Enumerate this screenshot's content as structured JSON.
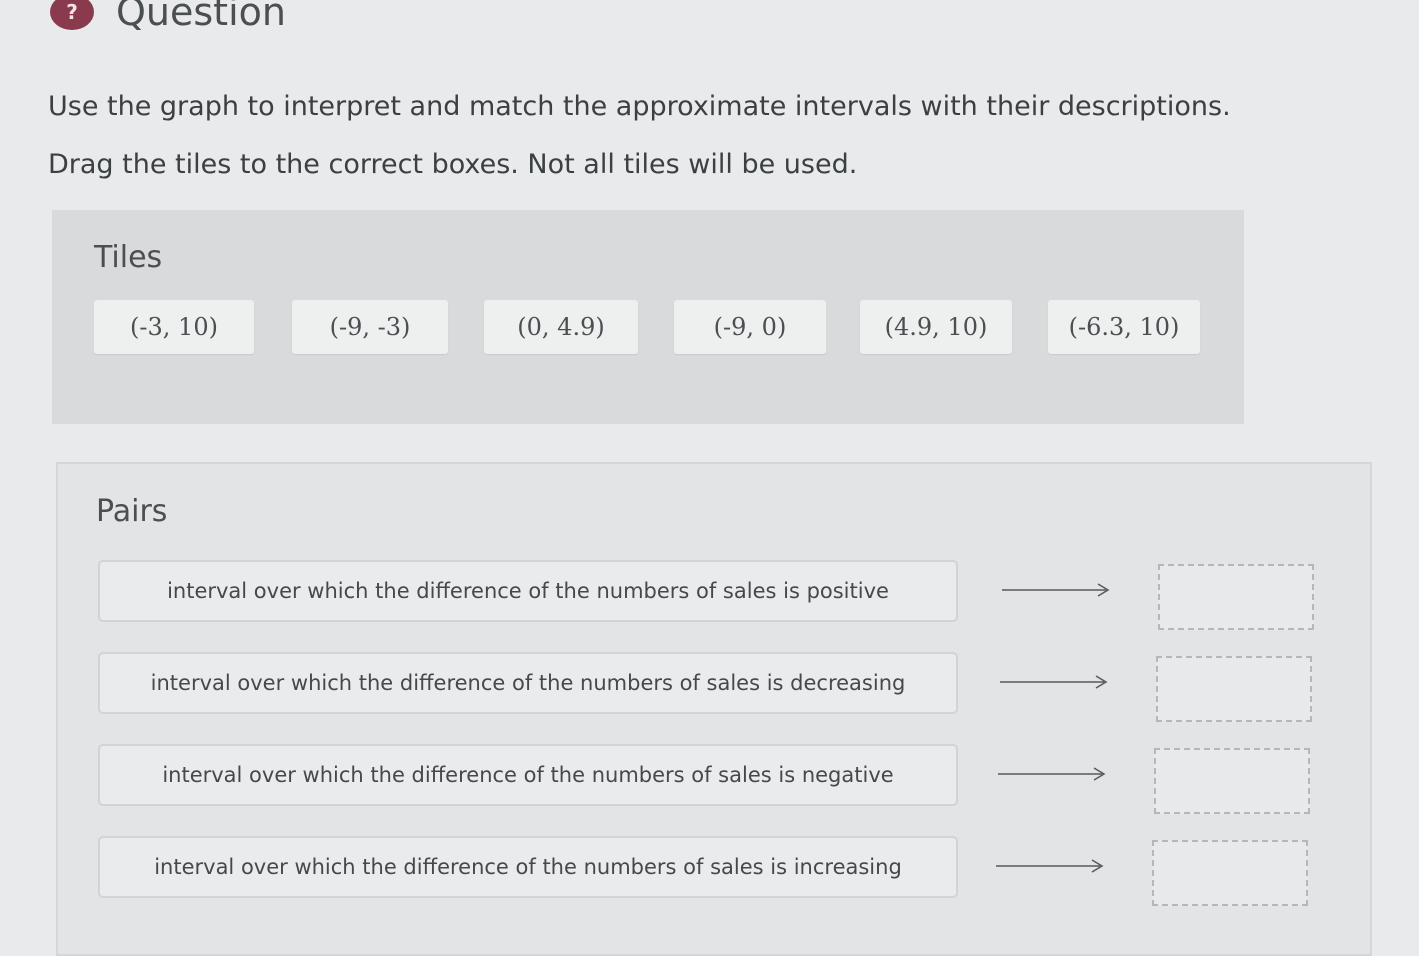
{
  "header": {
    "icon": "question-icon",
    "icon_glyph": "?",
    "title": "Question"
  },
  "instructions": {
    "line1": "Use the graph to interpret and match the approximate intervals with their descriptions.",
    "line2": "Drag the tiles to the correct boxes. Not all tiles will be used."
  },
  "tiles": {
    "label": "Tiles",
    "items": [
      "(-3, 10)",
      "(-9, -3)",
      "(0, 4.9)",
      "(-9, 0)",
      "(4.9, 10)",
      "(-6.3, 10)"
    ]
  },
  "pairs": {
    "label": "Pairs",
    "items": [
      {
        "description": "interval over which the difference of the numbers of sales is positive"
      },
      {
        "description": "interval over which the difference of the numbers of sales is decreasing"
      },
      {
        "description": "interval over which the difference of the numbers of sales is negative"
      },
      {
        "description": "interval over which the difference of the numbers of sales is increasing"
      }
    ]
  }
}
